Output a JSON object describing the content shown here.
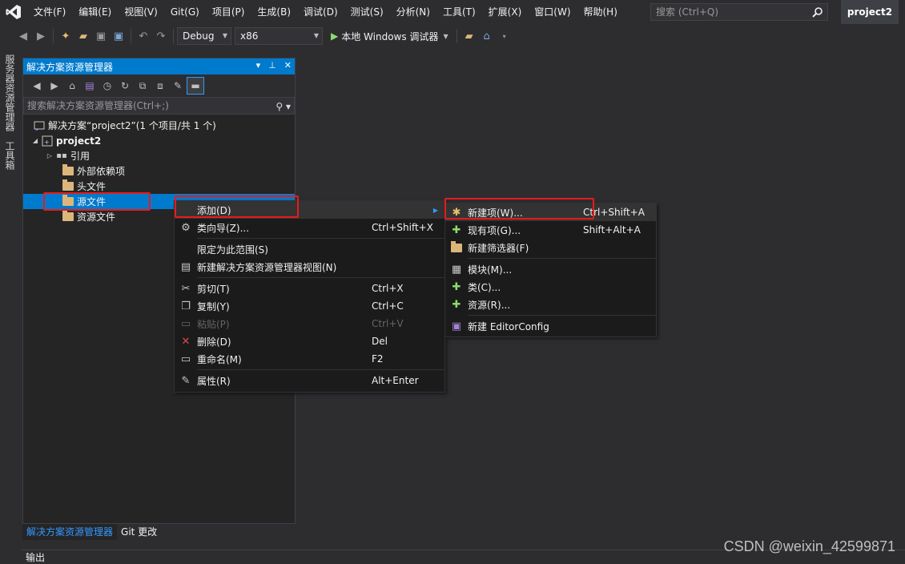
{
  "menubar": {
    "items": [
      "文件(F)",
      "编辑(E)",
      "视图(V)",
      "Git(G)",
      "项目(P)",
      "生成(B)",
      "调试(D)",
      "测试(S)",
      "分析(N)",
      "工具(T)",
      "扩展(X)",
      "窗口(W)",
      "帮助(H)"
    ],
    "search_placeholder": "搜索 (Ctrl+Q)",
    "project_name": "project2"
  },
  "toolbar": {
    "config": "Debug",
    "platform": "x86",
    "run_label": "本地 Windows 调试器"
  },
  "vertical_tabs": [
    "服务器资源管理器",
    "工具箱"
  ],
  "solution_explorer": {
    "title": "解决方案资源管理器",
    "search_placeholder": "搜索解决方案资源管理器(Ctrl+;)",
    "tree": {
      "solution": "解决方案“project2”(1 个项目/共 1 个)",
      "project": "project2",
      "references": "引用",
      "external_deps": "外部依赖项",
      "header_files": "头文件",
      "source_files": "源文件",
      "resource_files": "资源文件"
    },
    "bottom_tabs": [
      "解决方案资源管理器",
      "Git 更改"
    ]
  },
  "context_menu": {
    "add": "添加(D)",
    "class_wizard": {
      "label": "类向导(Z)...",
      "shortcut": "Ctrl+Shift+X"
    },
    "scope": "限定为此范围(S)",
    "new_view": "新建解决方案资源管理器视图(N)",
    "cut": {
      "label": "剪切(T)",
      "shortcut": "Ctrl+X"
    },
    "copy": {
      "label": "复制(Y)",
      "shortcut": "Ctrl+C"
    },
    "paste": {
      "label": "粘贴(P)",
      "shortcut": "Ctrl+V"
    },
    "delete": {
      "label": "删除(D)",
      "shortcut": "Del"
    },
    "rename": {
      "label": "重命名(M)",
      "shortcut": "F2"
    },
    "properties": {
      "label": "属性(R)",
      "shortcut": "Alt+Enter"
    }
  },
  "submenu": {
    "new_item": {
      "label": "新建项(W)...",
      "shortcut": "Ctrl+Shift+A"
    },
    "existing_item": {
      "label": "现有项(G)...",
      "shortcut": "Shift+Alt+A"
    },
    "new_filter": "新建筛选器(F)",
    "module": "模块(M)...",
    "class": "类(C)...",
    "resource": "资源(R)...",
    "editorconfig": "新建 EditorConfig"
  },
  "output_tab": "输出",
  "watermark": "CSDN @weixin_42599871",
  "colors": {
    "accent": "#007acc",
    "highlight_box": "#e81b1b",
    "background": "#2d2d30"
  }
}
